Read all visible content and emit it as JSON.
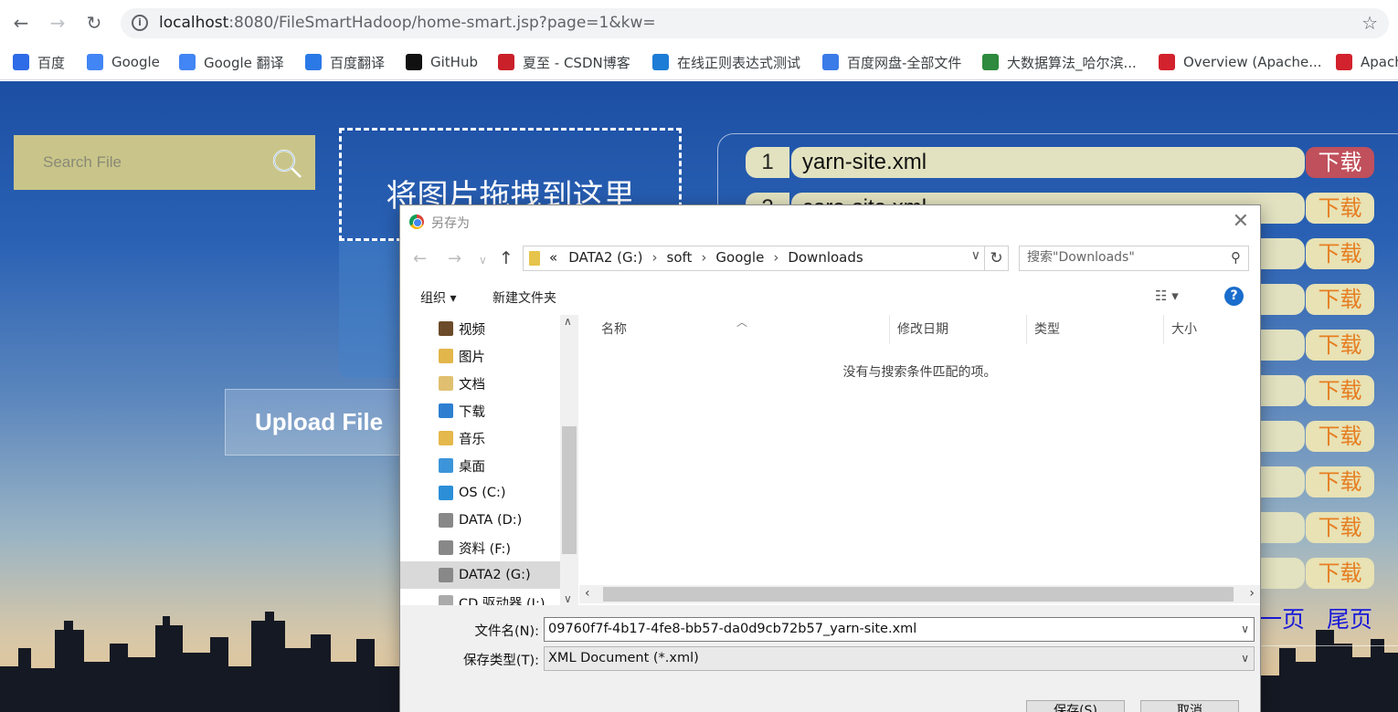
{
  "browser": {
    "url_host": "localhost",
    "url_rest": ":8080/FileSmartHadoop/home-smart.jsp?page=1&kw=",
    "bookmarks": [
      {
        "label": "百度",
        "icon": "baidu-paw-icon",
        "color": "#2e6be6"
      },
      {
        "label": "Google",
        "icon": "google-g-icon",
        "color": "#4285f4"
      },
      {
        "label": "Google 翻译",
        "icon": "google-translate-icon",
        "color": "#4285f4"
      },
      {
        "label": "百度翻译",
        "icon": "baidu-translate-icon",
        "color": "#2b79e6"
      },
      {
        "label": "GitHub",
        "icon": "github-icon",
        "color": "#111111"
      },
      {
        "label": "夏至 - CSDN博客",
        "icon": "csdn-icon",
        "color": "#c9202a"
      },
      {
        "label": "在线正则表达式测试",
        "icon": "regex-icon",
        "color": "#1d7cd6"
      },
      {
        "label": "百度网盘-全部文件",
        "icon": "baidu-pan-icon",
        "color": "#3b7be8"
      },
      {
        "label": "大数据算法_哈尔滨...",
        "icon": "book-icon",
        "color": "#2d8a3e"
      },
      {
        "label": "Overview (Apache...",
        "icon": "apache-feather-icon",
        "color": "#d2222d"
      },
      {
        "label": "Apach",
        "icon": "apache-feather-icon",
        "color": "#d2222d"
      }
    ]
  },
  "page": {
    "search_placeholder": "Search File",
    "drop_zone_text": "将图片拖拽到这里",
    "upload_label": "Upload File",
    "files": [
      {
        "num": "1",
        "name": "yarn-site.xml",
        "download": "下载",
        "active": true
      },
      {
        "num": "2",
        "name": "core-site.xml",
        "download": "下载",
        "active": false
      },
      {
        "num": "",
        "name": "",
        "download": "下载",
        "active": false
      },
      {
        "num": "",
        "name": "",
        "download": "下载",
        "active": false
      },
      {
        "num": "",
        "name": "",
        "download": "下载",
        "active": false
      },
      {
        "num": "",
        "name": "",
        "download": "下载",
        "active": false
      },
      {
        "num": "",
        "name": "",
        "download": "下载",
        "active": false
      },
      {
        "num": "",
        "name": "",
        "download": "下载",
        "active": false
      },
      {
        "num": "",
        "name": "",
        "download": "下载",
        "active": false
      },
      {
        "num": "",
        "name": "",
        "download": "下载",
        "active": false
      }
    ],
    "pager_next": "一页",
    "pager_last": "尾页"
  },
  "dialog": {
    "title": "另存为",
    "path": [
      "«",
      "DATA2 (G:)",
      "soft",
      "Google",
      "Downloads"
    ],
    "search_placeholder": "搜索\"Downloads\"",
    "organize": "组织 ▾",
    "new_folder": "新建文件夹",
    "tree": [
      {
        "label": "视频",
        "icon": "video-folder-icon",
        "color": "#6b4b2a"
      },
      {
        "label": "图片",
        "icon": "pictures-folder-icon",
        "color": "#e2b64a"
      },
      {
        "label": "文档",
        "icon": "documents-folder-icon",
        "color": "#e0c070"
      },
      {
        "label": "下载",
        "icon": "downloads-folder-icon",
        "color": "#2f7fd1"
      },
      {
        "label": "音乐",
        "icon": "music-folder-icon",
        "color": "#e5b84c"
      },
      {
        "label": "桌面",
        "icon": "desktop-folder-icon",
        "color": "#3d95d9"
      },
      {
        "label": "OS (C:)",
        "icon": "windows-drive-icon",
        "color": "#2b8fd8"
      },
      {
        "label": "DATA (D:)",
        "icon": "drive-icon",
        "color": "#888888"
      },
      {
        "label": "资料 (F:)",
        "icon": "drive-icon",
        "color": "#888888"
      },
      {
        "label": "DATA2 (G:)",
        "icon": "drive-icon",
        "color": "#888888"
      },
      {
        "label": "CD 驱动器 (I:)",
        "icon": "cd-drive-icon",
        "color": "#aaaaaa"
      }
    ],
    "columns": [
      "名称",
      "修改日期",
      "类型",
      "大小"
    ],
    "empty_message": "没有与搜索条件匹配的项。",
    "filename_label": "文件名(N):",
    "filename_value": "09760f7f-4b17-4fe8-bb57-da0d9cb72b57_yarn-site.xml",
    "filetype_label": "保存类型(T):",
    "filetype_value": "XML Document (*.xml)",
    "save_label": "保存(S)",
    "cancel_label": "取消"
  }
}
